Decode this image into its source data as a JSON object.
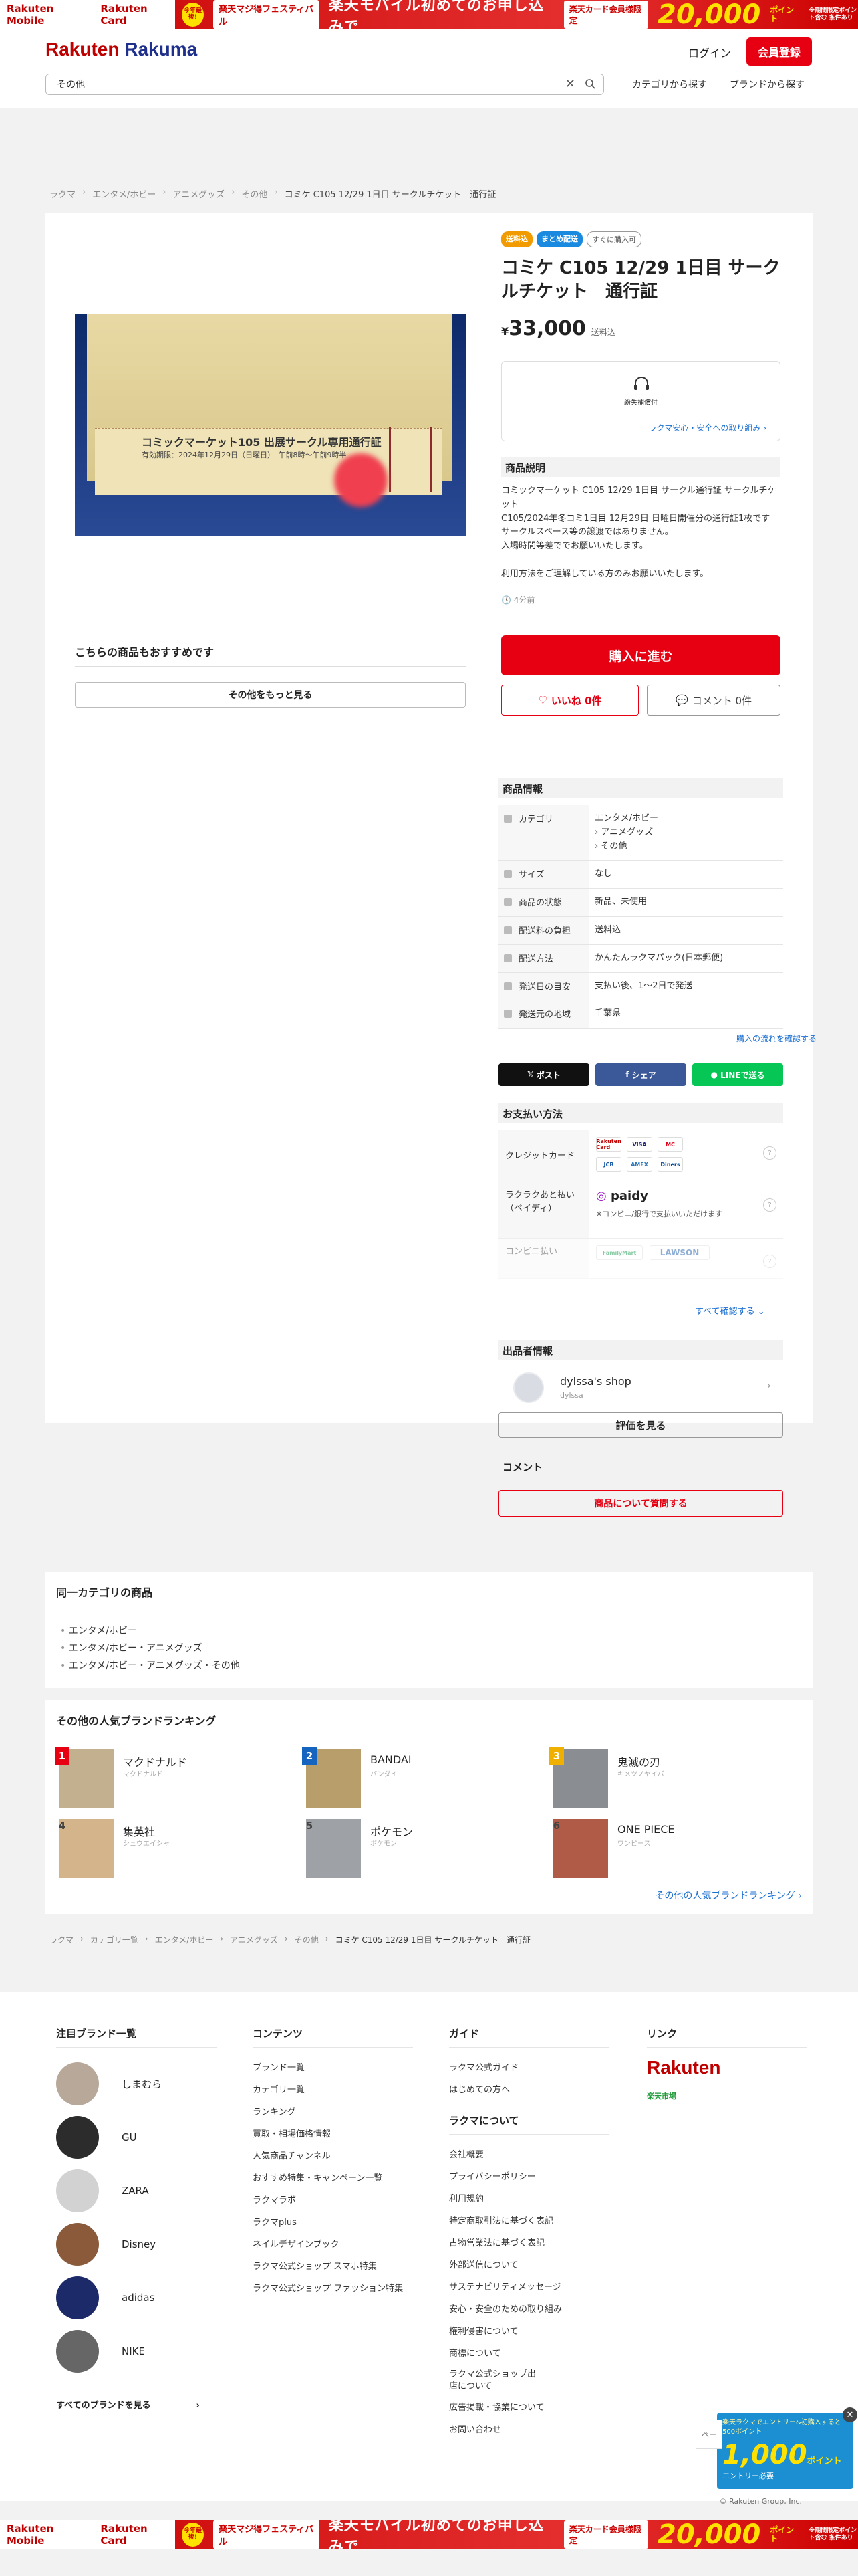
{
  "banner": {
    "left1": "Rakuten Mobile",
    "left2": "Rakuten Card",
    "tag": "今年最後!",
    "fes": "楽天マジ得フェスティバル",
    "message": "楽天モバイル初めてのお申し込みで",
    "card": "楽天カード会員様限定",
    "points": "20,000",
    "points_unit": "ポイント",
    "note": "※期間限定ポイント含む 条件あり"
  },
  "header": {
    "logo_a": "Rakuten",
    "logo_b": "Rakuma",
    "login": "ログイン",
    "register": "会員登録",
    "search_value": "その他",
    "nav": [
      "カテゴリから探す",
      "ブランドから探す"
    ]
  },
  "breadcrumb": [
    "ラクマ",
    "エンタメ/ホビー",
    "アニメグッズ",
    "その他",
    "コミケ C105 12/29 1日目 サークルチケット　通行証"
  ],
  "product": {
    "badges": [
      "送料込",
      "まとめ配送",
      "すぐに購入可"
    ],
    "title": "コミケ C105 12/29 1日目 サークルチケット　通行証",
    "price_symbol": "¥",
    "price": "33,000",
    "shipping": "送料込",
    "assure_label": "紛失補償付",
    "assure_link": "ラクマ安心・安全への取り組み",
    "image_text": "コミックマーケット105 出展サークル専用通行証",
    "image_date": "有効期限：2024年12月29日（日曜日）　午前8時〜午前9時半"
  },
  "description": {
    "title": "商品説明",
    "body": "コミックマーケット C105 12/29 1日目 サークル通行証 サークルチケット\nC105/2024年冬コミ1日目 12月29日 日曜日開催分の通行証1枚です\nサークルスペース等の譲渡ではありません。\n入場時間等差ででお願いいたします。\n\n利用方法をご理解している方のみお願いいたします。",
    "time": "4分前"
  },
  "actions": {
    "buy": "購入に進む",
    "like": "いいね 0件",
    "comment": "コメント 0件"
  },
  "recommend": {
    "title": "こちらの商品もおすすめです",
    "button": "その他をもっと見る"
  },
  "info": {
    "title": "商品情報",
    "rows": [
      {
        "k": "カテゴリ",
        "v": "エンタメ/ホビー\n› アニメグッズ\n› その他"
      },
      {
        "k": "サイズ",
        "v": "なし"
      },
      {
        "k": "商品の状態",
        "v": "新品、未使用"
      },
      {
        "k": "配送料の負担",
        "v": "送料込"
      },
      {
        "k": "配送方法",
        "v": "かんたんラクマパック(日本郵便)"
      },
      {
        "k": "発送日の目安",
        "v": "支払い後、1〜2日で発送"
      },
      {
        "k": "発送元の地域",
        "v": "千葉県"
      }
    ],
    "flow_link": "購入の流れを確認する"
  },
  "share": [
    "ポスト",
    "シェア",
    "LINEで送る"
  ],
  "payment": {
    "title": "お支払い方法",
    "rows": [
      {
        "k": "クレジットカード",
        "logos": [
          "Rakuten Card",
          "VISA",
          "MC",
          "JCB",
          "AMEX",
          "Diners"
        ]
      },
      {
        "k": "ラクラクあと払い（ペイディ）",
        "logo": "paidy",
        "note": "※コンビニ/銀行で支払いいただけます"
      },
      {
        "k": "コンビニ払い",
        "logos": [
          "FamilyMart",
          "LAWSON"
        ]
      }
    ],
    "see_all": "すべて確認する"
  },
  "seller": {
    "title": "出品者情報",
    "name": "dylssa's shop",
    "sub": "dylssa",
    "eval_button": "評価を見る"
  },
  "comment": {
    "title": "コメント",
    "ask_button": "商品について質問する"
  },
  "same_category": {
    "title": "同一カテゴリの商品",
    "items": [
      "エンタメ/ホビー",
      "エンタメ/ホビー・アニメグッズ",
      "エンタメ/ホビー・アニメグッズ・その他"
    ]
  },
  "ranking": {
    "title": "その他の人気ブランドランキング",
    "items": [
      {
        "n": "1",
        "name": "マクドナルド",
        "kana": "マクドナルド"
      },
      {
        "n": "2",
        "name": "BANDAI",
        "kana": "バンダイ"
      },
      {
        "n": "3",
        "name": "鬼滅の刃",
        "kana": "キメツノヤイバ"
      },
      {
        "n": "4",
        "name": "集英社",
        "kana": "シュウエイシャ"
      },
      {
        "n": "5",
        "name": "ポケモン",
        "kana": "ポケモン"
      },
      {
        "n": "6",
        "name": "ONE PIECE",
        "kana": "ワンピース"
      }
    ],
    "more": "その他の人気ブランドランキング"
  },
  "breadcrumb2": [
    "ラクマ",
    "カテゴリ一覧",
    "エンタメ/ホビー",
    "アニメグッズ",
    "その他",
    "コミケ C105 12/29 1日目 サークルチケット　通行証"
  ],
  "footer": {
    "brands_title": "注目ブランド一覧",
    "brands": [
      "しまむら",
      "GU",
      "ZARA",
      "Disney",
      "adidas",
      "NIKE"
    ],
    "brands_all": "すべてのブランドを見る",
    "contents_title": "コンテンツ",
    "contents": [
      "ブランド一覧",
      "カテゴリ一覧",
      "ランキング",
      "買取・相場価格情報",
      "人気商品チャンネル",
      "おすすめ特集・キャンペーン一覧",
      "ラクマラボ",
      "ラクマplus",
      "ネイルデザインブック",
      "ラクマ公式ショップ スマホ特集",
      "ラクマ公式ショップ ファッション特集"
    ],
    "guide_title": "ガイド",
    "guide": [
      "ラクマ公式ガイド",
      "はじめての方へ"
    ],
    "about_title": "ラクマについて",
    "about": [
      "会社概要",
      "プライバシーポリシー",
      "利用規約",
      "特定商取引法に基づく表記",
      "古物営業法に基づく表記",
      "外部送信について",
      "サステナビリティメッセージ",
      "安心・安全のための取り組み",
      "権利侵害について",
      "商標について",
      "ラクマ公式ショップ出店について",
      "広告掲載・協業について",
      "お問い合わせ"
    ],
    "links_title": "リンク",
    "links": [
      "Rakuten",
      "楽天市場"
    ],
    "copyright": "© Rakuten Group, Inc."
  },
  "popup": {
    "text": "楽天ラクマでエントリー&初購入すると500ポイント",
    "points": "1,000",
    "unit": "ポイント",
    "sub": "エントリー必要",
    "tab": "ペー"
  }
}
